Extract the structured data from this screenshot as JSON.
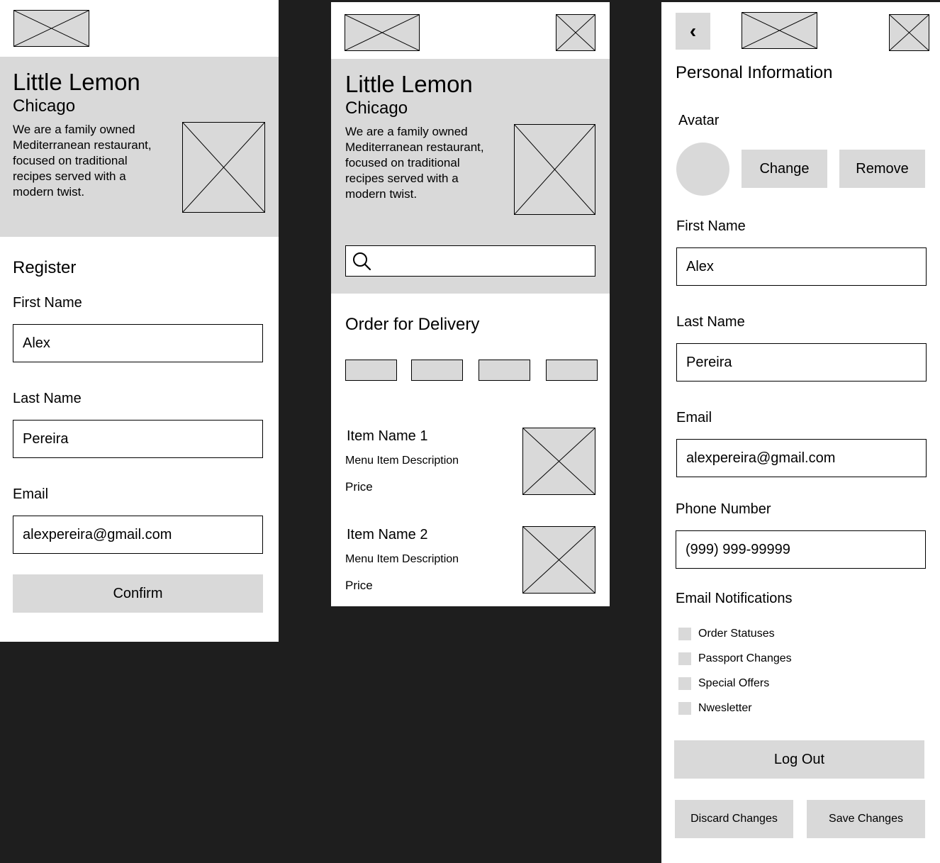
{
  "register_screen": {
    "hero": {
      "title": "Little Lemon",
      "city": "Chicago",
      "description": "We are a family owned Mediterranean restaurant, focused on traditional recipes served with a modern twist."
    },
    "form_title": "Register",
    "first_name_label": "First Name",
    "first_name_value": "Alex",
    "last_name_label": "Last Name",
    "last_name_value": "Pereira",
    "email_label": "Email",
    "email_value": "alexpereira@gmail.com",
    "confirm_label": "Confirm"
  },
  "home_screen": {
    "hero": {
      "title": "Little Lemon",
      "city": "Chicago",
      "description": "We are a family owned Mediterranean restaurant, focused on traditional recipes served with a modern twist."
    },
    "search_value": "",
    "section_title": "Order for Delivery",
    "menu_items": [
      {
        "name": "Item Name 1",
        "description": "Menu Item Description",
        "price": "Price"
      },
      {
        "name": "Item Name 2",
        "description": "Menu Item Description",
        "price": "Price"
      }
    ]
  },
  "profile_screen": {
    "back_glyph": "‹",
    "title": "Personal Information",
    "avatar_label": "Avatar",
    "change_label": "Change",
    "remove_label": "Remove",
    "first_name_label": "First Name",
    "first_name_value": "Alex",
    "last_name_label": "Last Name",
    "last_name_value": "Pereira",
    "email_label": "Email",
    "email_value": "alexpereira@gmail.com",
    "phone_label": "Phone Number",
    "phone_value": "(999) 999-99999",
    "notifications_label": "Email Notifications",
    "notifications": [
      "Order Statuses",
      "Passport Changes",
      "Special Offers",
      "Nwesletter"
    ],
    "logout_label": "Log Out",
    "discard_label": "Discard Changes",
    "save_label": "Save Changes"
  },
  "colors": {
    "placeholder_gray": "#d9d9d9",
    "canvas_dark": "#1e1e1e",
    "frame_bg": "#ffffff"
  }
}
